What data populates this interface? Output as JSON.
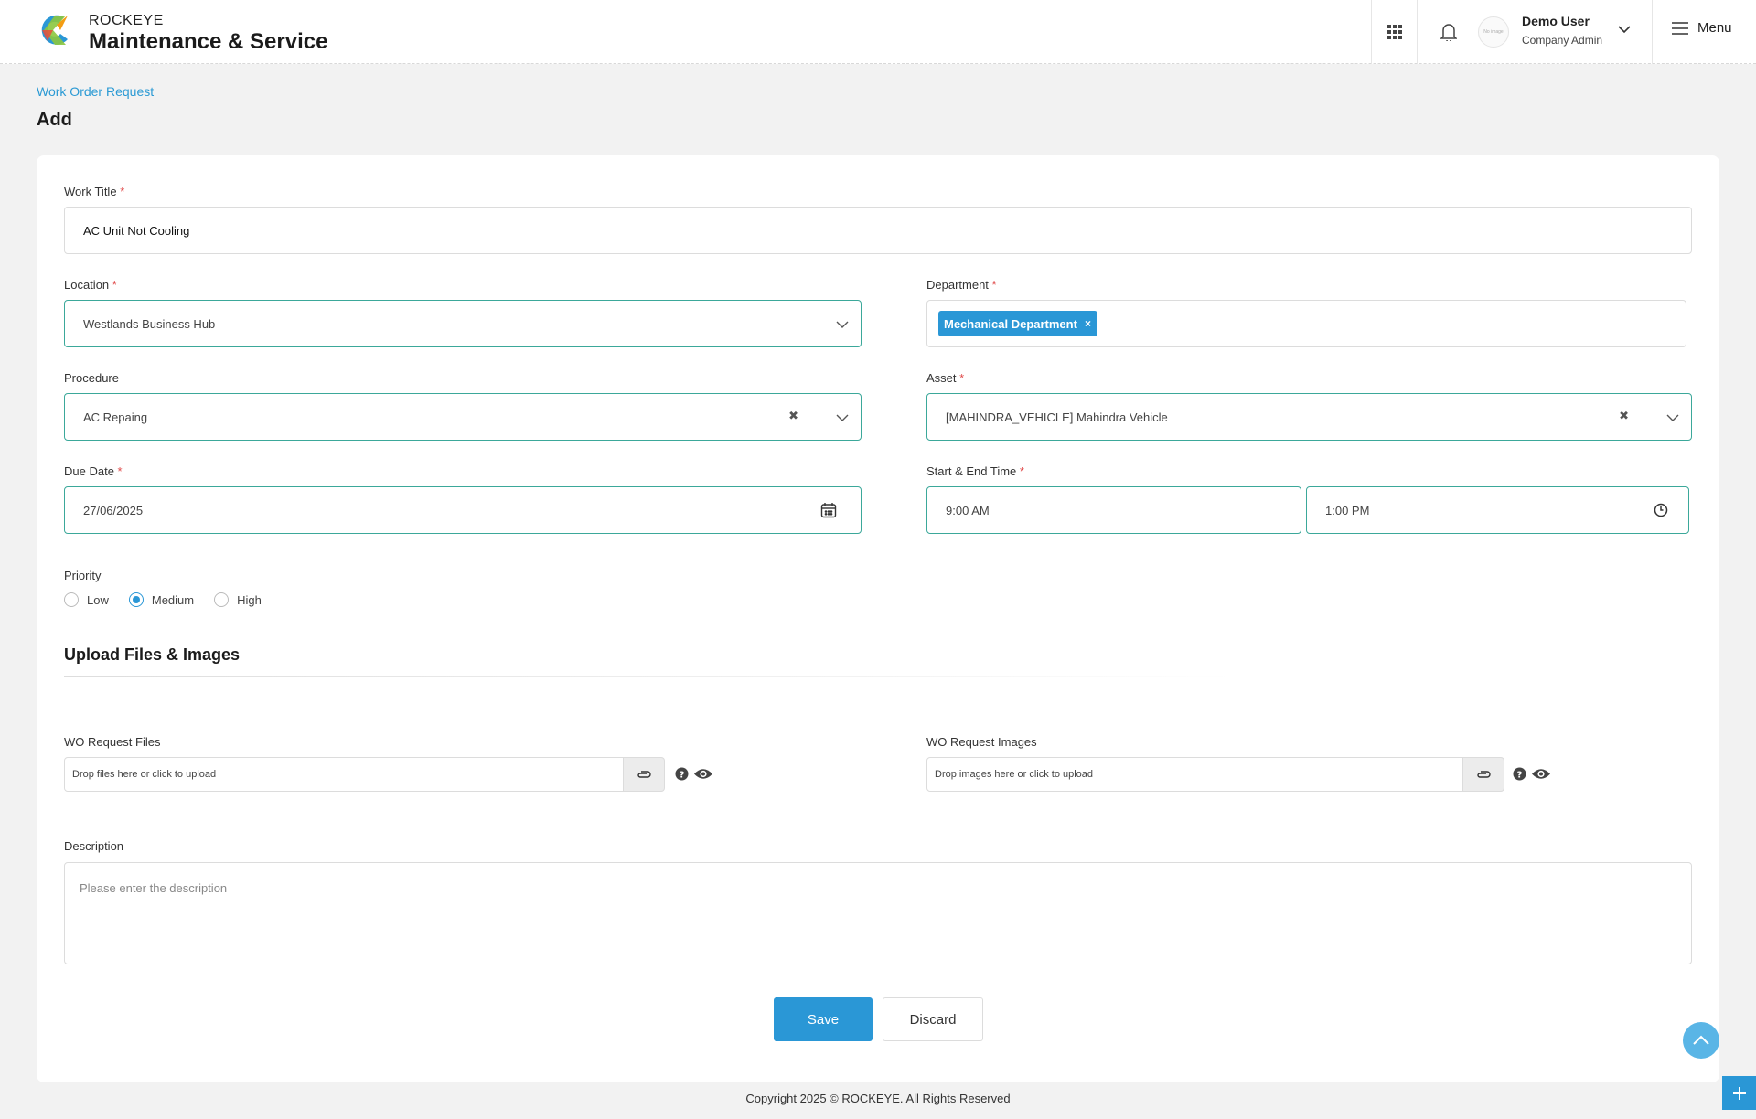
{
  "header": {
    "brand_top": "ROCKEYE",
    "brand_main": "Maintenance & Service",
    "avatar_text": "No image",
    "user_name": "Demo User",
    "user_role": "Company Admin",
    "menu_label": "Menu",
    "icons": [
      "apps-grid-icon",
      "bell-icon",
      "chevron-down-icon",
      "hamburger-icon"
    ]
  },
  "page": {
    "breadcrumb": "Work Order Request",
    "title": "Add"
  },
  "form": {
    "work_title": {
      "label": "Work Title",
      "required": "*",
      "value": "AC Unit Not Cooling"
    },
    "location": {
      "label": "Location",
      "required": "*",
      "value": "Westlands Business Hub"
    },
    "department": {
      "label": "Department",
      "required": "*",
      "tag": "Mechanical Department",
      "tag_remove": "×"
    },
    "procedure": {
      "label": "Procedure",
      "value": "AC Repaing",
      "clear": "✖"
    },
    "asset": {
      "label": "Asset",
      "required": "*",
      "value": "[MAHINDRA_VEHICLE] Mahindra Vehicle",
      "clear": "✖"
    },
    "due_date": {
      "label": "Due Date",
      "required": "*",
      "value": "27/06/2025"
    },
    "start_end_time": {
      "label": "Start & End Time",
      "required": "*",
      "start": "9:00 AM",
      "end": "1:00 PM"
    },
    "priority": {
      "label": "Priority",
      "options": [
        "Low",
        "Medium",
        "High"
      ],
      "selected": "Medium"
    },
    "upload_section_title": "Upload Files & Images",
    "wo_files": {
      "label": "WO Request Files",
      "placeholder": "Drop files here or click to upload"
    },
    "wo_images": {
      "label": "WO Request Images",
      "placeholder": "Drop images here or click to upload"
    },
    "description": {
      "label": "Description",
      "placeholder": "Please enter the description"
    },
    "save_label": "Save",
    "discard_label": "Discard"
  },
  "footer": {
    "copyright": "Copyright 2025 © ROCKEYE. All Rights Reserved"
  },
  "colors": {
    "accent": "#2a97d6",
    "teal_border": "#3ba89a",
    "required": "#e04b4b"
  }
}
